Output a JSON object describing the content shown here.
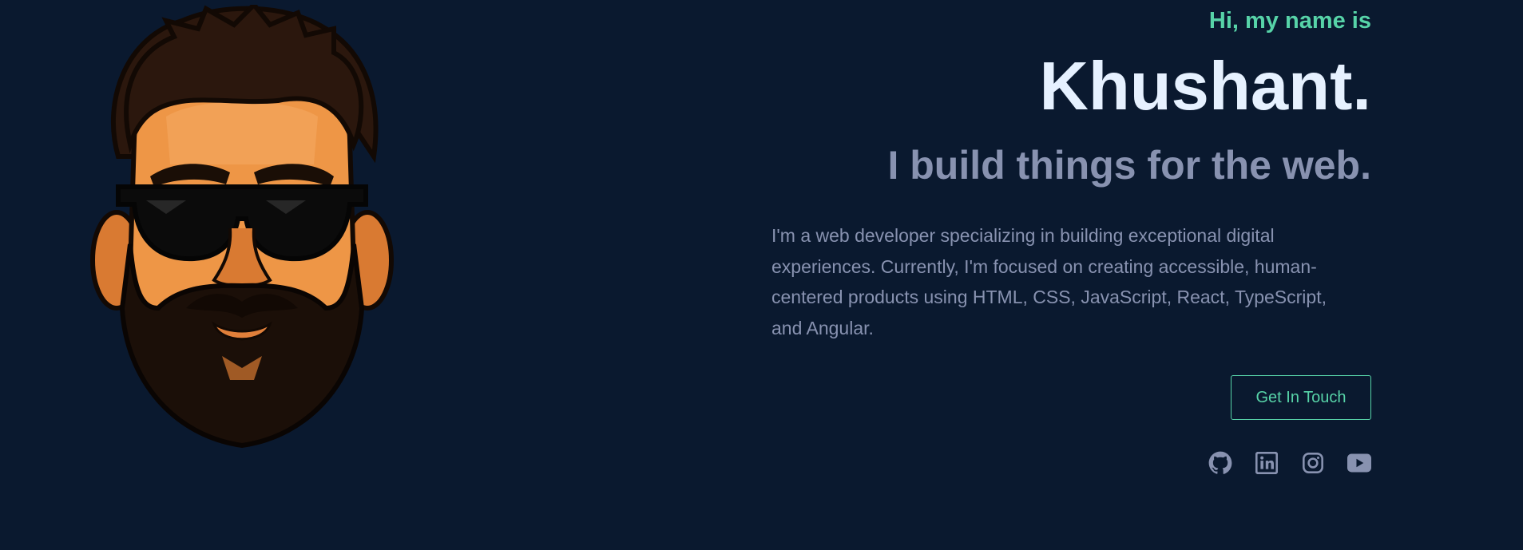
{
  "hero": {
    "greeting": "Hi, my name is",
    "name": "Khushant.",
    "tagline": "I build things for the web.",
    "bio": "I'm a web developer specializing in building exceptional digital experiences. Currently, I'm focused on creating accessible, human-centered products using HTML, CSS, JavaScript, React, TypeScript, and Angular.",
    "cta_label": "Get In Touch"
  },
  "socials": [
    {
      "icon": "github-icon"
    },
    {
      "icon": "linkedin-icon"
    },
    {
      "icon": "instagram-icon"
    },
    {
      "icon": "youtube-icon"
    }
  ],
  "colors": {
    "background": "#0a192f",
    "accent": "#57d3a8",
    "heading": "#e6f1ff",
    "muted": "#8892b0"
  }
}
